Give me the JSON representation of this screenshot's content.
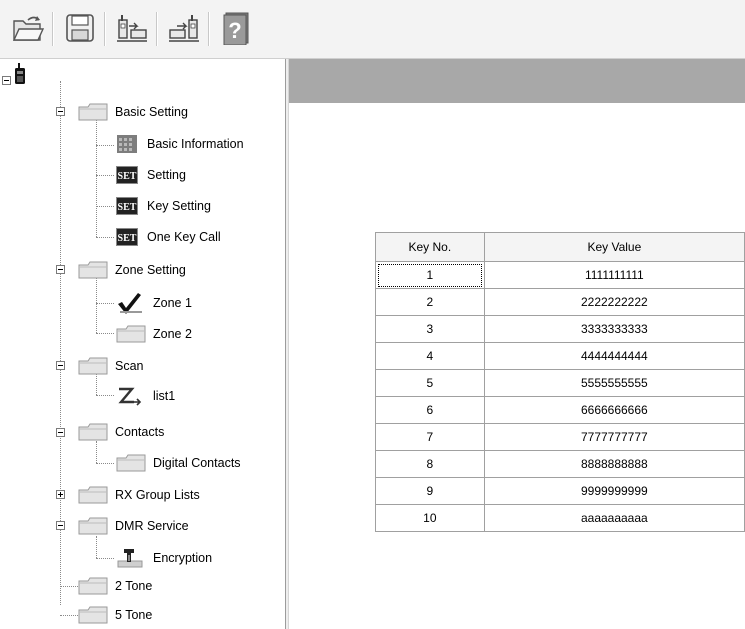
{
  "toolbar": {
    "buttons": [
      {
        "name": "open-icon"
      },
      {
        "name": "save-icon"
      },
      {
        "name": "read-from-radio-icon"
      },
      {
        "name": "write-to-radio-icon"
      },
      {
        "name": "help-icon",
        "label": "?"
      }
    ]
  },
  "tree": {
    "items": [
      {
        "label": "",
        "icon": "radio-icon"
      },
      {
        "label": "Basic Setting",
        "icon": "folder-icon"
      },
      {
        "label": "Basic Information",
        "icon": "grid-icon"
      },
      {
        "label": "Setting",
        "icon": "set-icon"
      },
      {
        "label": "Key Setting",
        "icon": "set-icon"
      },
      {
        "label": "One Key Call",
        "icon": "set-icon"
      },
      {
        "label": "Zone Setting",
        "icon": "folder-icon"
      },
      {
        "label": "Zone 1",
        "icon": "checkmark-icon"
      },
      {
        "label": "Zone 2",
        "icon": "folder-icon"
      },
      {
        "label": "Scan",
        "icon": "folder-icon"
      },
      {
        "label": "list1",
        "icon": "scan-list-icon"
      },
      {
        "label": "Contacts",
        "icon": "folder-icon"
      },
      {
        "label": "Digital Contacts",
        "icon": "folder-icon"
      },
      {
        "label": "RX Group Lists",
        "icon": "folder-icon"
      },
      {
        "label": "DMR Service",
        "icon": "folder-icon"
      },
      {
        "label": "Encryption",
        "icon": "encryption-icon"
      },
      {
        "label": "2 Tone",
        "icon": "folder-icon"
      },
      {
        "label": "5 Tone",
        "icon": "folder-icon"
      }
    ],
    "set_badge": "SET"
  },
  "table": {
    "headers": {
      "key_no": "Key No.",
      "key_value": "Key Value"
    },
    "rows": [
      {
        "no": "1",
        "value": "1111111111"
      },
      {
        "no": "2",
        "value": "2222222222"
      },
      {
        "no": "3",
        "value": "3333333333"
      },
      {
        "no": "4",
        "value": "4444444444"
      },
      {
        "no": "5",
        "value": "5555555555"
      },
      {
        "no": "6",
        "value": "6666666666"
      },
      {
        "no": "7",
        "value": "7777777777"
      },
      {
        "no": "8",
        "value": "8888888888"
      },
      {
        "no": "9",
        "value": "9999999999"
      },
      {
        "no": "10",
        "value": "aaaaaaaaaa"
      }
    ]
  },
  "colors": {
    "header_band": "#a8a8a8",
    "toolbar_bg": "#f3f3f3",
    "grid_line": "#a0a0a0"
  }
}
